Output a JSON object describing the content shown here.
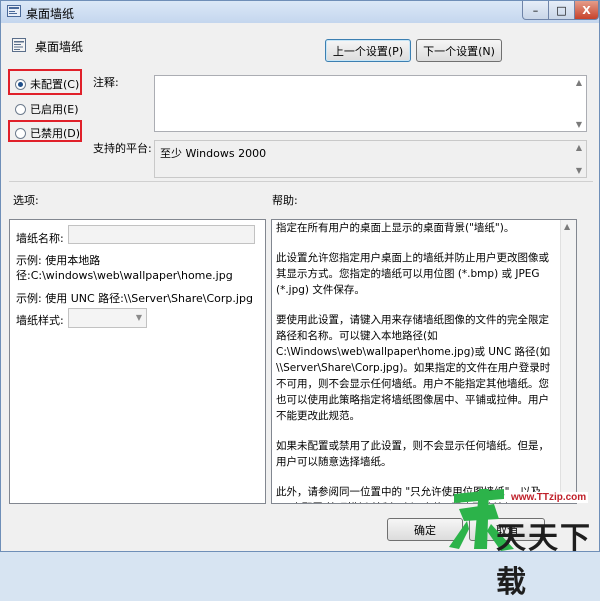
{
  "window": {
    "title": "桌面墙纸",
    "minimize": "–",
    "maximize": "□",
    "close": "X"
  },
  "header": {
    "policy_title": "桌面墙纸",
    "prev_button": "上一个设置(P)",
    "next_button": "下一个设置(N)"
  },
  "state": {
    "not_configured": "未配置(C)",
    "enabled": "已启用(E)",
    "disabled": "已禁用(D)",
    "selected": "not_configured"
  },
  "comment": {
    "label": "注释:",
    "value": ""
  },
  "platform": {
    "label": "支持的平台:",
    "value": "至少 Windows 2000"
  },
  "options": {
    "heading": "选项:",
    "wallpaper_name_label": "墙纸名称:",
    "wallpaper_name_value": "",
    "example_local": "示例: 使用本地路径:C:\\windows\\web\\wallpaper\\home.jpg",
    "example_unc": "示例: 使用 UNC 路径:\\\\Server\\Share\\Corp.jpg",
    "style_label": "墙纸样式:",
    "style_value": ""
  },
  "help": {
    "heading": "帮助:",
    "paragraphs": [
      "指定在所有用户的桌面上显示的桌面背景(\"墙纸\")。",
      "此设置允许您指定用户桌面上的墙纸并防止用户更改图像或其显示方式。您指定的墙纸可以用位图 (*.bmp) 或 JPEG (*.jpg) 文件保存。",
      "要使用此设置，请键入用来存储墙纸图像的文件的完全限定路径和名称。可以键入本地路径(如 C:\\Windows\\web\\wallpaper\\home.jpg)或 UNC 路径(如 \\\\Server\\Share\\Corp.jpg)。如果指定的文件在用户登录时不可用，则不会显示任何墙纸。用户不能指定其他墙纸。您也可以使用此策略指定将墙纸图像居中、平铺或拉伸。用户不能更改此规范。",
      "如果未配置或禁用了此设置，则不会显示任何墙纸。但是，用户可以随意选择墙纸。",
      "此外，请参阅同一位置中的 \"只允许使用位图墙纸\"，以及 \"用户配置\\管理模板\\控制面板\" 中的 \"阻止更改墙纸\" 设置。"
    ]
  },
  "footer": {
    "ok": "确定",
    "cancel": "取消"
  },
  "watermark": {
    "url": "www.TTzip.com",
    "text": "天天下载"
  },
  "colors": {
    "highlight_box": "#e0202a",
    "watermark_green": "#2cb34a"
  }
}
